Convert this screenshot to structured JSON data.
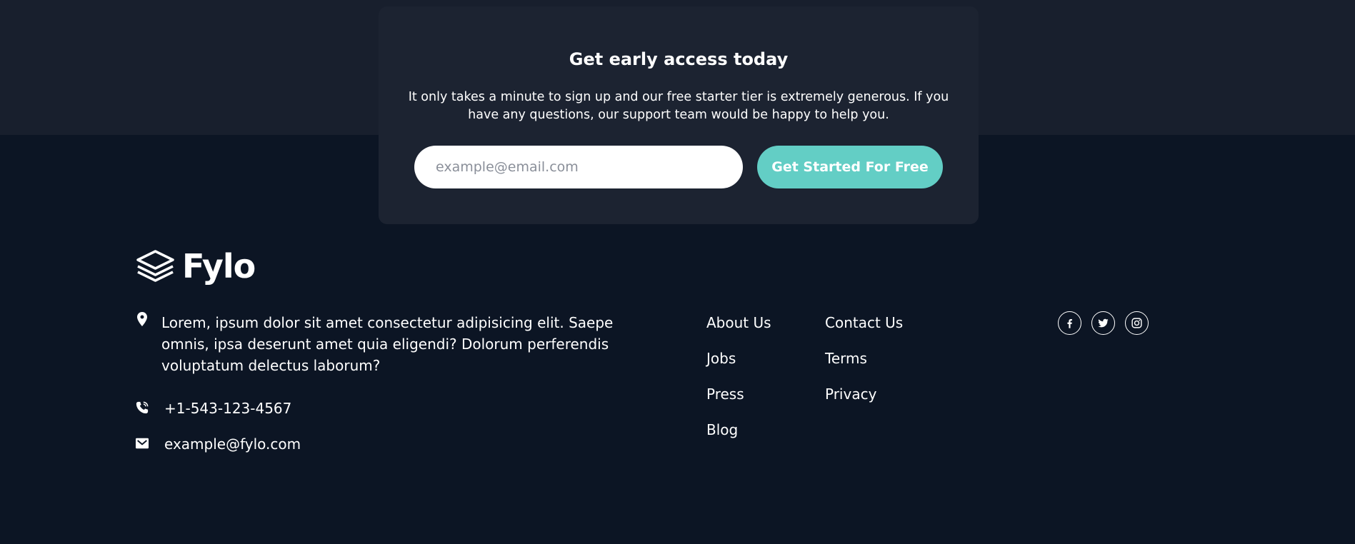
{
  "cta": {
    "title": "Get early access today",
    "description": "It only takes a minute to sign up and our free starter tier is extremely generous. If you have any questions, our support team would be happy to help you.",
    "email_placeholder": "example@email.com",
    "button_label": "Get Started For Free"
  },
  "footer": {
    "logo_text": "Fylo",
    "address": "Lorem, ipsum dolor sit amet consectetur adipisicing elit. Saepe omnis, ipsa deserunt amet quia eligendi? Dolorum perferendis voluptatum delectus laborum?",
    "phone": "+1-543-123-4567",
    "email": "example@fylo.com",
    "links_col1": [
      "About Us",
      "Jobs",
      "Press",
      "Blog"
    ],
    "links_col2": [
      "Contact Us",
      "Terms",
      "Privacy"
    ],
    "social_icons": [
      "facebook-icon",
      "twitter-icon",
      "instagram-icon"
    ]
  },
  "colors": {
    "page_bg": "#0c1524",
    "top_band_bg": "#181f2d",
    "card_bg": "#1c2331",
    "accent": "#63cec5",
    "text": "#ffffff"
  }
}
